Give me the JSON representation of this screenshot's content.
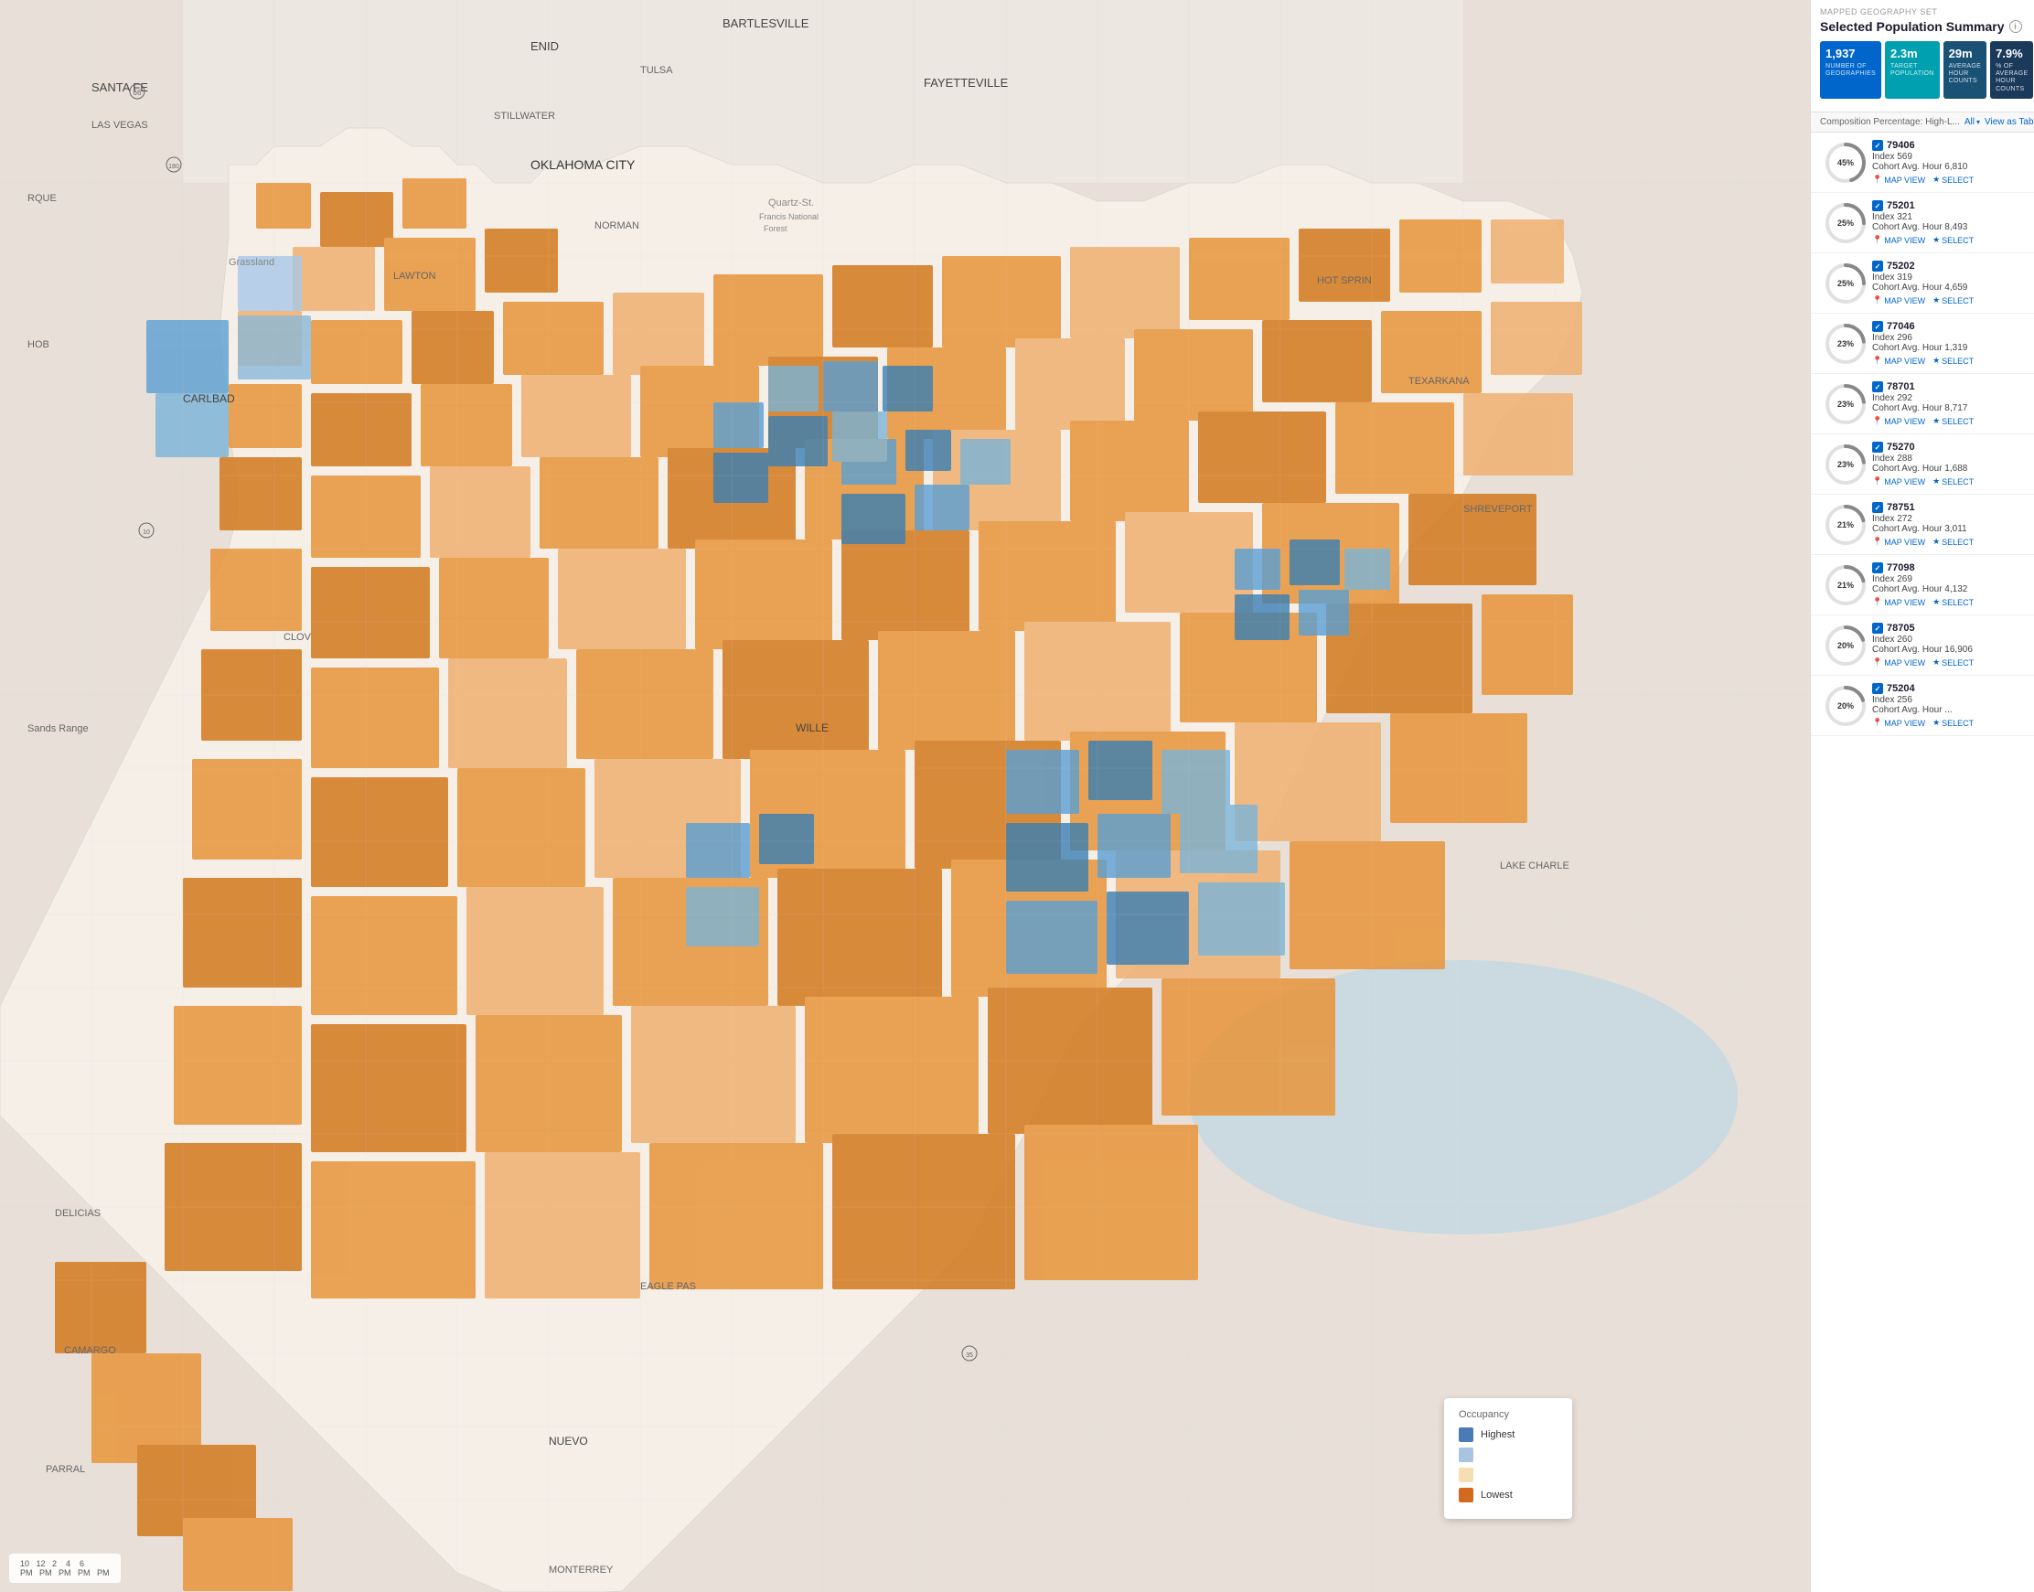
{
  "sidebar": {
    "mapped_geo_label": "MAPPED GEOGRAPHY SET",
    "panel_title": "Selected Population Summary",
    "stats": [
      {
        "value": "1,937",
        "label": "NUMBER OF GEOGRAPHIES",
        "color": "blue"
      },
      {
        "value": "2.3m",
        "label": "TARGET POPULATION",
        "color": "teal"
      },
      {
        "value": "29m",
        "label": "AVERAGE HOUR COUNTS",
        "color": "navy"
      },
      {
        "value": "7.9%",
        "label": "% OF AVERAGE HOUR COUNTS",
        "color": "darkblue"
      }
    ],
    "filter_label": "Composition Percentage: High-L...",
    "filter_all": "All",
    "view_as_table": "View as Table",
    "geo_items": [
      {
        "zip": "79406",
        "percent": 45,
        "index": "Index 569",
        "cohort": "Cohort Avg. Hour 6,810"
      },
      {
        "zip": "75201",
        "percent": 25,
        "index": "Index 321",
        "cohort": "Cohort Avg. Hour 8,493"
      },
      {
        "zip": "75202",
        "percent": 25,
        "index": "Index 319",
        "cohort": "Cohort Avg. Hour 4,659"
      },
      {
        "zip": "77046",
        "percent": 23,
        "index": "Index 296",
        "cohort": "Cohort Avg. Hour 1,319"
      },
      {
        "zip": "78701",
        "percent": 23,
        "index": "Index 292",
        "cohort": "Cohort Avg. Hour 8,717"
      },
      {
        "zip": "75270",
        "percent": 23,
        "index": "Index 288",
        "cohort": "Cohort Avg. Hour 1,688"
      },
      {
        "zip": "78751",
        "percent": 21,
        "index": "Index 272",
        "cohort": "Cohort Avg. Hour 3,011"
      },
      {
        "zip": "77098",
        "percent": 21,
        "index": "Index 269",
        "cohort": "Cohort Avg. Hour 4,132"
      },
      {
        "zip": "78705",
        "percent": 20,
        "index": "Index 260",
        "cohort": "Cohort Avg. Hour 16,906"
      },
      {
        "zip": "75204",
        "percent": 20,
        "index": "Index 256",
        "cohort": "Cohort Avg. Hour ..."
      }
    ],
    "map_view_label": "MAP VIEW",
    "select_label": "SELECT"
  },
  "legend": {
    "title": "Occupancy",
    "items": [
      {
        "label": "Highest",
        "color": "#4a7bb7"
      },
      {
        "label": "",
        "color": "#a8c4e0"
      },
      {
        "label": "",
        "color": "#f5deb3"
      },
      {
        "label": "Lowest",
        "color": "#d2691e"
      }
    ]
  },
  "timeline": {
    "times": [
      "10 PM",
      "12 PM",
      "2 PM",
      "4 PM",
      "6 PM"
    ]
  }
}
